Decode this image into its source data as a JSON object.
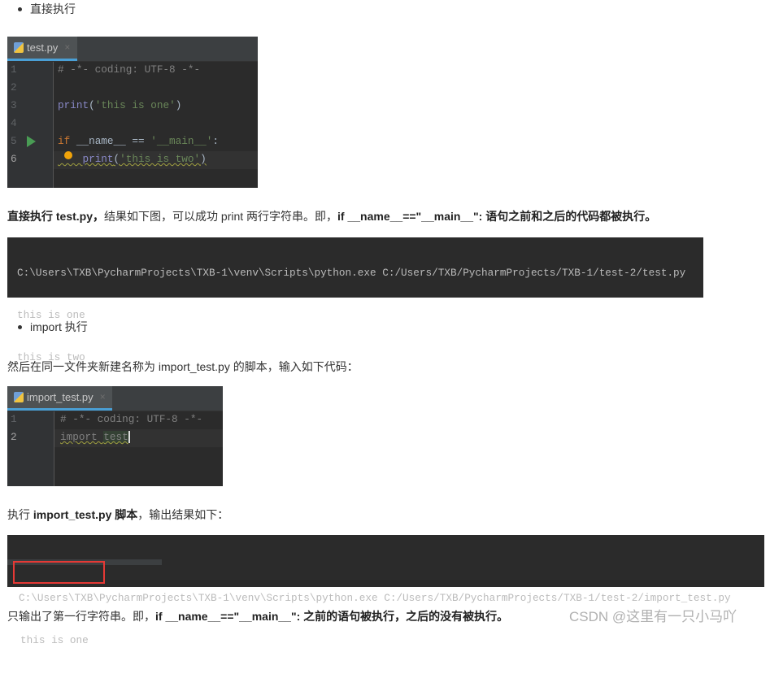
{
  "section1": {
    "bullet": "直接执行"
  },
  "editor1": {
    "tab": "test.py",
    "close": "×",
    "line_numbers": [
      "1",
      "2",
      "3",
      "4",
      "5",
      "6"
    ],
    "lines": {
      "l1": "# -*- coding: UTF-8 -*-",
      "l3_fn": "print",
      "l3_a": "(",
      "l3_str": "'this is one'",
      "l3_b": ")",
      "l5_kw": "if",
      "l5_a": " __name__ == ",
      "l5_str": "'__main__'",
      "l5_b": ":",
      "l6_fn": "print",
      "l6_a": "(",
      "l6_str": "'this is two'",
      "l6_b": ")"
    }
  },
  "para1": {
    "b1": "直接执行 test.py，",
    "t1": "结果如下图，可以成功 print 两行字符串。即，",
    "b2": "if __name__==\"__main__\": 语句之前和之后的代码都被执行。"
  },
  "console1": {
    "lines": [
      "C:\\Users\\TXB\\PycharmProjects\\TXB-1\\venv\\Scripts\\python.exe C:/Users/TXB/PycharmProjects/TXB-1/test-2/test.py",
      "this is one",
      "this is two"
    ]
  },
  "section2": {
    "bullet": "import 执行"
  },
  "para2": {
    "text": "然后在同一文件夹新建名称为 import_test.py 的脚本，输入如下代码："
  },
  "editor2": {
    "tab": "import_test.py",
    "close": "×",
    "line_numbers": [
      "1",
      "2"
    ],
    "lines": {
      "l1": "# -*- coding: UTF-8 -*-",
      "l2_a": "import ",
      "l2_b": "test"
    }
  },
  "para3": {
    "t1": "执行 ",
    "b1": "import_test.py 脚本",
    "t2": "，输出结果如下："
  },
  "console2": {
    "lines": [
      "C:\\Users\\TXB\\PycharmProjects\\TXB-1\\venv\\Scripts\\python.exe C:/Users/TXB/PycharmProjects/TXB-1/test-2/import_test.py",
      "this is one"
    ],
    "highlight_color": "#e53935"
  },
  "para4": {
    "t1": "只输出了第一行字符串。即，",
    "b1": "if __name__==\"__main__\": 之前的语句被执行，之后的没有被执行。"
  },
  "watermark": "CSDN @这里有一只小马吖"
}
